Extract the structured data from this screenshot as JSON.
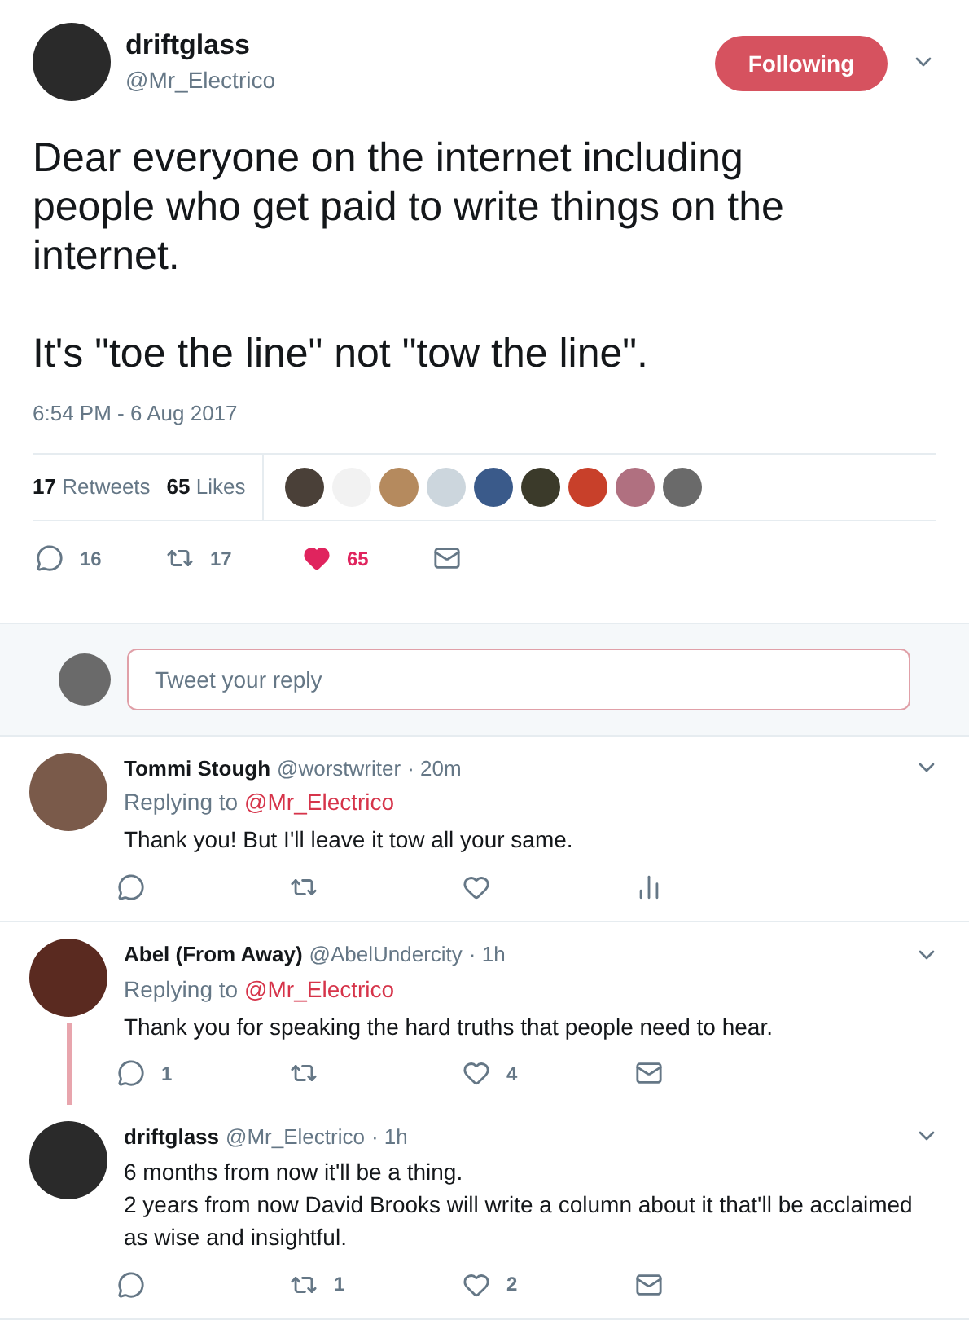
{
  "tweet": {
    "name": "driftglass",
    "handle": "@Mr_Electrico",
    "follow_button": "Following",
    "following": true,
    "paragraphs": [
      "Dear everyone on the internet including people who get paid to write things on the internet.",
      "It's \"toe the line\" not \"tow the line\"."
    ],
    "timestamp": "6:54 PM - 6 Aug 2017",
    "stats": [
      {
        "count": "17",
        "label": "Retweets"
      },
      {
        "count": "65",
        "label": "Likes"
      }
    ],
    "liker_avatars": [
      {
        "color": "#4a4038"
      },
      {
        "color": "#f2f2f2"
      },
      {
        "color": "#b58a5e"
      },
      {
        "color": "#ccd6dd"
      },
      {
        "color": "#3a5a8a"
      },
      {
        "color": "#3b3a2a"
      },
      {
        "color": "#c8402a"
      },
      {
        "color": "#b07080"
      },
      {
        "color": "#6a6a6a"
      }
    ],
    "actions": [
      {
        "kind": "reply",
        "count": "16",
        "on": false
      },
      {
        "kind": "retweet",
        "count": "17",
        "on": false
      },
      {
        "kind": "like",
        "count": "65",
        "on": true
      },
      {
        "kind": "message",
        "on": false
      }
    ]
  },
  "reply_box": {
    "placeholder": "Tweet your reply"
  },
  "replies": [
    {
      "name": "Tommi Stough",
      "handle": "@worstwriter",
      "time": "· 20m",
      "color": "#7a5a4a",
      "replying_label": "Replying to",
      "replying_to": "@Mr_Electrico",
      "lines": [
        "Thank you! But I'll leave it tow all your same."
      ],
      "thread_line": false,
      "actions": [
        {
          "kind": "reply",
          "on": false
        },
        {
          "kind": "retweet",
          "on": false
        },
        {
          "kind": "like",
          "on": false
        },
        {
          "kind": "analytics",
          "on": false
        }
      ]
    },
    {
      "name": "Abel (From Away)",
      "handle": "@AbelUndercity",
      "time": "· 1h",
      "color": "#5a2a20",
      "replying_label": "Replying to",
      "replying_to": "@Mr_Electrico",
      "lines": [
        "Thank you for speaking the hard truths that people need to hear."
      ],
      "thread_line": true,
      "actions": [
        {
          "kind": "reply",
          "count": "1",
          "on": false
        },
        {
          "kind": "retweet",
          "on": false
        },
        {
          "kind": "like",
          "count": "4",
          "on": false
        },
        {
          "kind": "message",
          "on": false
        }
      ]
    },
    {
      "name": "driftglass",
      "handle": "@Mr_Electrico",
      "time": "· 1h",
      "color": "#2a2a2a",
      "lines": [
        "6 months from now it'll be a thing.",
        "2 years from now David Brooks will write a column about it that'll be acclaimed as wise and insightful."
      ],
      "thread_line": false,
      "actions": [
        {
          "kind": "reply",
          "on": false
        },
        {
          "kind": "retweet",
          "count": "1",
          "on": false
        },
        {
          "kind": "like",
          "count": "2",
          "on": false
        },
        {
          "kind": "message",
          "on": false
        }
      ]
    }
  ]
}
